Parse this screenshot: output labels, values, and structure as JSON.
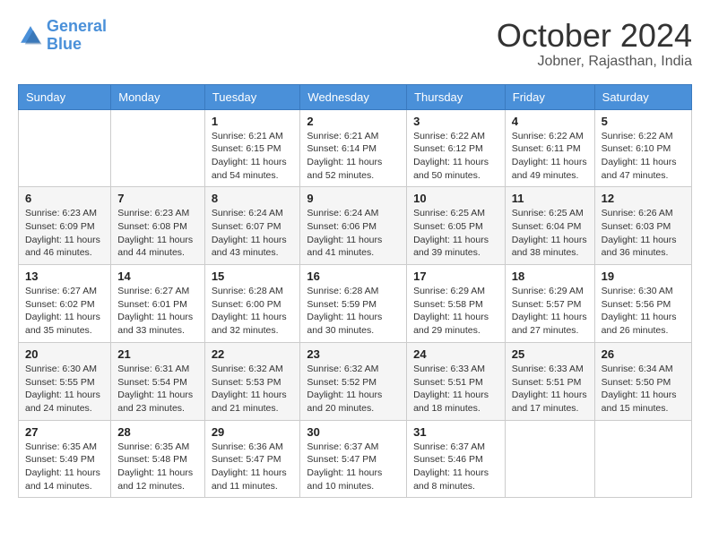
{
  "header": {
    "logo_line1": "General",
    "logo_line2": "Blue",
    "month": "October 2024",
    "location": "Jobner, Rajasthan, India"
  },
  "days_of_week": [
    "Sunday",
    "Monday",
    "Tuesday",
    "Wednesday",
    "Thursday",
    "Friday",
    "Saturday"
  ],
  "weeks": [
    [
      {
        "day": "",
        "sunrise": "",
        "sunset": "",
        "daylight": ""
      },
      {
        "day": "",
        "sunrise": "",
        "sunset": "",
        "daylight": ""
      },
      {
        "day": "1",
        "sunrise": "Sunrise: 6:21 AM",
        "sunset": "Sunset: 6:15 PM",
        "daylight": "Daylight: 11 hours and 54 minutes."
      },
      {
        "day": "2",
        "sunrise": "Sunrise: 6:21 AM",
        "sunset": "Sunset: 6:14 PM",
        "daylight": "Daylight: 11 hours and 52 minutes."
      },
      {
        "day": "3",
        "sunrise": "Sunrise: 6:22 AM",
        "sunset": "Sunset: 6:12 PM",
        "daylight": "Daylight: 11 hours and 50 minutes."
      },
      {
        "day": "4",
        "sunrise": "Sunrise: 6:22 AM",
        "sunset": "Sunset: 6:11 PM",
        "daylight": "Daylight: 11 hours and 49 minutes."
      },
      {
        "day": "5",
        "sunrise": "Sunrise: 6:22 AM",
        "sunset": "Sunset: 6:10 PM",
        "daylight": "Daylight: 11 hours and 47 minutes."
      }
    ],
    [
      {
        "day": "6",
        "sunrise": "Sunrise: 6:23 AM",
        "sunset": "Sunset: 6:09 PM",
        "daylight": "Daylight: 11 hours and 46 minutes."
      },
      {
        "day": "7",
        "sunrise": "Sunrise: 6:23 AM",
        "sunset": "Sunset: 6:08 PM",
        "daylight": "Daylight: 11 hours and 44 minutes."
      },
      {
        "day": "8",
        "sunrise": "Sunrise: 6:24 AM",
        "sunset": "Sunset: 6:07 PM",
        "daylight": "Daylight: 11 hours and 43 minutes."
      },
      {
        "day": "9",
        "sunrise": "Sunrise: 6:24 AM",
        "sunset": "Sunset: 6:06 PM",
        "daylight": "Daylight: 11 hours and 41 minutes."
      },
      {
        "day": "10",
        "sunrise": "Sunrise: 6:25 AM",
        "sunset": "Sunset: 6:05 PM",
        "daylight": "Daylight: 11 hours and 39 minutes."
      },
      {
        "day": "11",
        "sunrise": "Sunrise: 6:25 AM",
        "sunset": "Sunset: 6:04 PM",
        "daylight": "Daylight: 11 hours and 38 minutes."
      },
      {
        "day": "12",
        "sunrise": "Sunrise: 6:26 AM",
        "sunset": "Sunset: 6:03 PM",
        "daylight": "Daylight: 11 hours and 36 minutes."
      }
    ],
    [
      {
        "day": "13",
        "sunrise": "Sunrise: 6:27 AM",
        "sunset": "Sunset: 6:02 PM",
        "daylight": "Daylight: 11 hours and 35 minutes."
      },
      {
        "day": "14",
        "sunrise": "Sunrise: 6:27 AM",
        "sunset": "Sunset: 6:01 PM",
        "daylight": "Daylight: 11 hours and 33 minutes."
      },
      {
        "day": "15",
        "sunrise": "Sunrise: 6:28 AM",
        "sunset": "Sunset: 6:00 PM",
        "daylight": "Daylight: 11 hours and 32 minutes."
      },
      {
        "day": "16",
        "sunrise": "Sunrise: 6:28 AM",
        "sunset": "Sunset: 5:59 PM",
        "daylight": "Daylight: 11 hours and 30 minutes."
      },
      {
        "day": "17",
        "sunrise": "Sunrise: 6:29 AM",
        "sunset": "Sunset: 5:58 PM",
        "daylight": "Daylight: 11 hours and 29 minutes."
      },
      {
        "day": "18",
        "sunrise": "Sunrise: 6:29 AM",
        "sunset": "Sunset: 5:57 PM",
        "daylight": "Daylight: 11 hours and 27 minutes."
      },
      {
        "day": "19",
        "sunrise": "Sunrise: 6:30 AM",
        "sunset": "Sunset: 5:56 PM",
        "daylight": "Daylight: 11 hours and 26 minutes."
      }
    ],
    [
      {
        "day": "20",
        "sunrise": "Sunrise: 6:30 AM",
        "sunset": "Sunset: 5:55 PM",
        "daylight": "Daylight: 11 hours and 24 minutes."
      },
      {
        "day": "21",
        "sunrise": "Sunrise: 6:31 AM",
        "sunset": "Sunset: 5:54 PM",
        "daylight": "Daylight: 11 hours and 23 minutes."
      },
      {
        "day": "22",
        "sunrise": "Sunrise: 6:32 AM",
        "sunset": "Sunset: 5:53 PM",
        "daylight": "Daylight: 11 hours and 21 minutes."
      },
      {
        "day": "23",
        "sunrise": "Sunrise: 6:32 AM",
        "sunset": "Sunset: 5:52 PM",
        "daylight": "Daylight: 11 hours and 20 minutes."
      },
      {
        "day": "24",
        "sunrise": "Sunrise: 6:33 AM",
        "sunset": "Sunset: 5:51 PM",
        "daylight": "Daylight: 11 hours and 18 minutes."
      },
      {
        "day": "25",
        "sunrise": "Sunrise: 6:33 AM",
        "sunset": "Sunset: 5:51 PM",
        "daylight": "Daylight: 11 hours and 17 minutes."
      },
      {
        "day": "26",
        "sunrise": "Sunrise: 6:34 AM",
        "sunset": "Sunset: 5:50 PM",
        "daylight": "Daylight: 11 hours and 15 minutes."
      }
    ],
    [
      {
        "day": "27",
        "sunrise": "Sunrise: 6:35 AM",
        "sunset": "Sunset: 5:49 PM",
        "daylight": "Daylight: 11 hours and 14 minutes."
      },
      {
        "day": "28",
        "sunrise": "Sunrise: 6:35 AM",
        "sunset": "Sunset: 5:48 PM",
        "daylight": "Daylight: 11 hours and 12 minutes."
      },
      {
        "day": "29",
        "sunrise": "Sunrise: 6:36 AM",
        "sunset": "Sunset: 5:47 PM",
        "daylight": "Daylight: 11 hours and 11 minutes."
      },
      {
        "day": "30",
        "sunrise": "Sunrise: 6:37 AM",
        "sunset": "Sunset: 5:47 PM",
        "daylight": "Daylight: 11 hours and 10 minutes."
      },
      {
        "day": "31",
        "sunrise": "Sunrise: 6:37 AM",
        "sunset": "Sunset: 5:46 PM",
        "daylight": "Daylight: 11 hours and 8 minutes."
      },
      {
        "day": "",
        "sunrise": "",
        "sunset": "",
        "daylight": ""
      },
      {
        "day": "",
        "sunrise": "",
        "sunset": "",
        "daylight": ""
      }
    ]
  ]
}
